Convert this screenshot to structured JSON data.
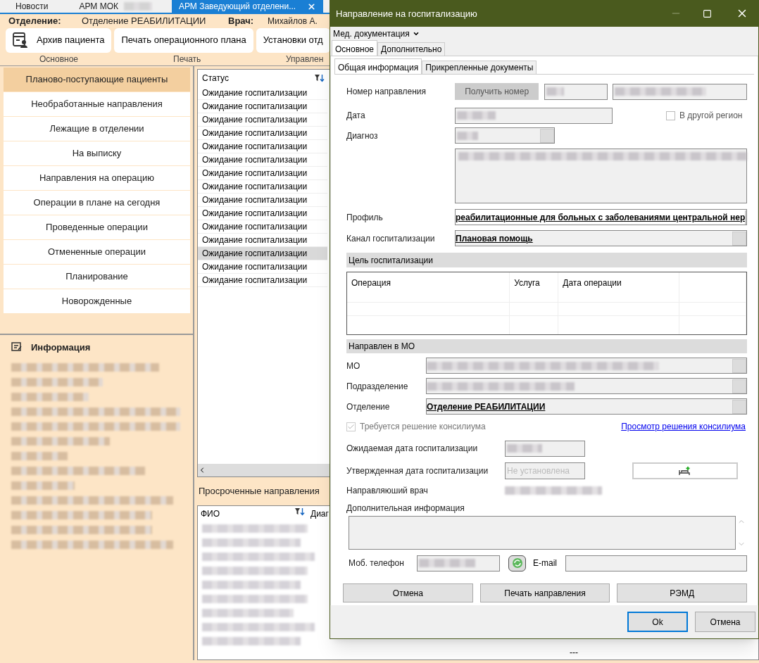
{
  "app_tabs": [
    {
      "label": "Новости",
      "selected": false,
      "redacted_suffix": false,
      "closable": false
    },
    {
      "label": "АРМ МОК",
      "selected": false,
      "redacted_suffix": true,
      "closable": false
    },
    {
      "label": "АРМ Заведующий отделени...",
      "selected": true,
      "redacted_suffix": false,
      "closable": true
    }
  ],
  "header": {
    "department_label": "Отделение:",
    "department": "Отделение РЕАБИЛИТАЦИИ",
    "doctor_label": "Врач:",
    "doctor": "Михайлов А."
  },
  "toolbar": {
    "buttons": [
      {
        "label": "Архив пациента",
        "kind": "with_icon"
      },
      {
        "label": "Печать операционного плана",
        "kind": "plain"
      },
      {
        "label": "Установки отд",
        "kind": "plain"
      }
    ],
    "groups": [
      "Основное",
      "Печать",
      "Управлен"
    ]
  },
  "nav": [
    {
      "label": "Планово-поступающие пациенты",
      "selected": true
    },
    {
      "label": "Необработанные направления",
      "selected": false
    },
    {
      "label": "Лежащие в отделении",
      "selected": false
    },
    {
      "label": "На выписку",
      "selected": false
    },
    {
      "label": "Направления на операцию",
      "selected": false
    },
    {
      "label": "Операции в плане на сегодня",
      "selected": false
    },
    {
      "label": "Проведенные операции",
      "selected": false
    },
    {
      "label": "Отмененные операции",
      "selected": false
    },
    {
      "label": "Планирование",
      "selected": false
    },
    {
      "label": "Новорожденные",
      "selected": false
    }
  ],
  "info": {
    "title": "Информация"
  },
  "status_table": {
    "column": "Статус",
    "rows": [
      {
        "status": "Ожидание госпитализации",
        "selected": false
      },
      {
        "status": "Ожидание госпитализации",
        "selected": false
      },
      {
        "status": "Ожидание госпитализации",
        "selected": false
      },
      {
        "status": "Ожидание госпитализации",
        "selected": false
      },
      {
        "status": "Ожидание госпитализации",
        "selected": false
      },
      {
        "status": "Ожидание госпитализации",
        "selected": false
      },
      {
        "status": "Ожидание госпитализации",
        "selected": false
      },
      {
        "status": "Ожидание госпитализации",
        "selected": false
      },
      {
        "status": "Ожидание госпитализации",
        "selected": false
      },
      {
        "status": "Ожидание госпитализации",
        "selected": false
      },
      {
        "status": "Ожидание госпитализации",
        "selected": false
      },
      {
        "status": "Ожидание госпитализации",
        "selected": false
      },
      {
        "status": "Ожидание госпитализации",
        "selected": true
      },
      {
        "status": "Ожидание госпитализации",
        "selected": false
      },
      {
        "status": "Ожидание госпитализации",
        "selected": false
      }
    ]
  },
  "overdue": {
    "title": "Просроченные направления",
    "columns": [
      "ФИО",
      "Диаг"
    ],
    "last_cell": "---"
  },
  "dialog": {
    "title": "Направление на госпитализацию",
    "menu": "Мед. документация",
    "tabs": [
      {
        "label": "Основное",
        "selected": true
      },
      {
        "label": "Дополнительно",
        "selected": false
      }
    ],
    "subtabs": [
      {
        "label": "Общая информация",
        "selected": true
      },
      {
        "label": "Прикрепленные документы",
        "selected": false
      }
    ],
    "number": {
      "label": "Номер направления",
      "button": "Получить номер",
      "disabled": true
    },
    "date": {
      "label": "Дата"
    },
    "region": {
      "label": "В другой регион",
      "checked": false
    },
    "diagnosis": {
      "label": "Диагноз"
    },
    "profile": {
      "label": "Профиль",
      "value": "реабилитационные для больных с заболеваниями центральной нер"
    },
    "channel": {
      "label": "Канал госпитализации",
      "value": "Плановая помощь"
    },
    "goal": {
      "title": "Цель госпитализации",
      "columns": [
        "Операция",
        "Услуга",
        "Дата операции"
      ]
    },
    "referred": {
      "title": "Направлен в МО",
      "mo_label": "МО",
      "subdivision_label": "Подразделение",
      "department_label": "Отделение",
      "department": "Отделение РЕАБИЛИТАЦИИ"
    },
    "council": {
      "label": "Требуется решение консилиума",
      "checked": true,
      "disabled": true,
      "link": "Просмотр решения консилиума"
    },
    "expected_date": {
      "label": "Ожидаемая дата госпитализации"
    },
    "approved_date": {
      "label": "Утвержденная дата госпитализации",
      "placeholder": "Не установлена"
    },
    "doctor": {
      "label": "Направляюший врач"
    },
    "extra_info": {
      "label": "Дополнительная информация"
    },
    "phone": {
      "label": "Моб. телефон"
    },
    "email": {
      "label": "E-mail"
    },
    "actions": [
      "Отмена",
      "Печать направления",
      "РЭМД"
    ],
    "footer": [
      {
        "label": "Ok",
        "focused": true
      },
      {
        "label": "Отмена",
        "focused": false
      }
    ]
  }
}
